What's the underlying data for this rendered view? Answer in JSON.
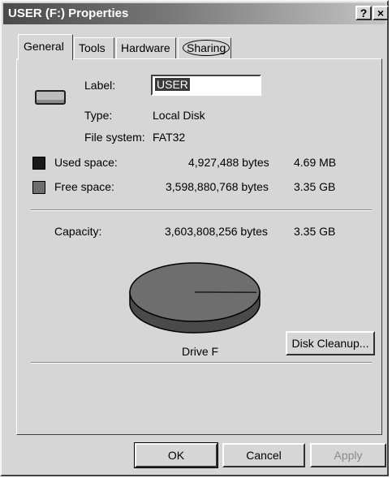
{
  "window": {
    "title": "USER (F:) Properties",
    "help_label": "?",
    "close_label": "×"
  },
  "tabs": [
    {
      "label": "General"
    },
    {
      "label": "Tools"
    },
    {
      "label": "Hardware"
    },
    {
      "label": "Sharing"
    }
  ],
  "general": {
    "label_caption": "Label:",
    "label_value": "USER",
    "type_caption": "Type:",
    "type_value": "Local Disk",
    "fs_caption": "File system:",
    "fs_value": "FAT32",
    "used": {
      "caption": "Used space:",
      "bytes": "4,927,488 bytes",
      "size": "4.69 MB",
      "color": "#1a1a1a"
    },
    "free": {
      "caption": "Free space:",
      "bytes": "3,598,880,768 bytes",
      "size": "3.35 GB",
      "color": "#6e6e6e"
    },
    "capacity": {
      "caption": "Capacity:",
      "bytes": "3,603,808,256 bytes",
      "size": "3.35 GB"
    },
    "used_fraction": 0.0014,
    "drive_name": "Drive F",
    "cleanup_label": "Disk Cleanup..."
  },
  "buttons": {
    "ok": "OK",
    "cancel": "Cancel",
    "apply": "Apply"
  },
  "icons": {
    "drive": "drive-icon"
  }
}
